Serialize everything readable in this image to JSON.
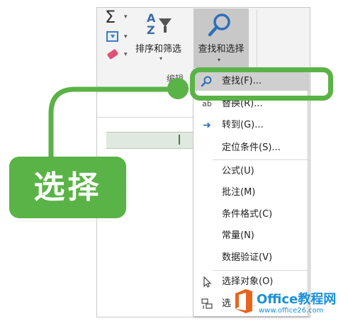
{
  "ribbon": {
    "sort_filter_label": "排序和筛选",
    "find_select_label": "查找和选择",
    "group_label": "编辑"
  },
  "menu": {
    "items": [
      {
        "label": "查找(F)...",
        "icon": "magnifier-icon",
        "highlighted": true
      },
      {
        "label": "替换(R)...",
        "icon": "replace-icon",
        "highlighted": false
      },
      {
        "label": "转到(G)...",
        "icon": "arrow-right-icon",
        "highlighted": false
      },
      {
        "label": "定位条件(S)...",
        "icon": "",
        "highlighted": false
      },
      {
        "label": "公式(U)",
        "icon": "",
        "highlighted": false
      },
      {
        "label": "批注(M)",
        "icon": "",
        "highlighted": false
      },
      {
        "label": "条件格式(C)",
        "icon": "",
        "highlighted": false
      },
      {
        "label": "常量(N)",
        "icon": "",
        "highlighted": false
      },
      {
        "label": "数据验证(V)",
        "icon": "",
        "highlighted": false
      },
      {
        "label": "选择对象(O)",
        "icon": "cursor-icon",
        "highlighted": false
      },
      {
        "label": "选",
        "icon": "selection-pane-icon",
        "highlighted": false
      }
    ]
  },
  "callout": {
    "label": "选择",
    "color": "#5ab346"
  },
  "watermark": {
    "brand": "Office教程网",
    "url": "www.office26.com"
  },
  "colors": {
    "accent_green": "#5ab346",
    "menu_highlight": "#cfcfcf",
    "watermark_blue": "#1a8fd9"
  }
}
